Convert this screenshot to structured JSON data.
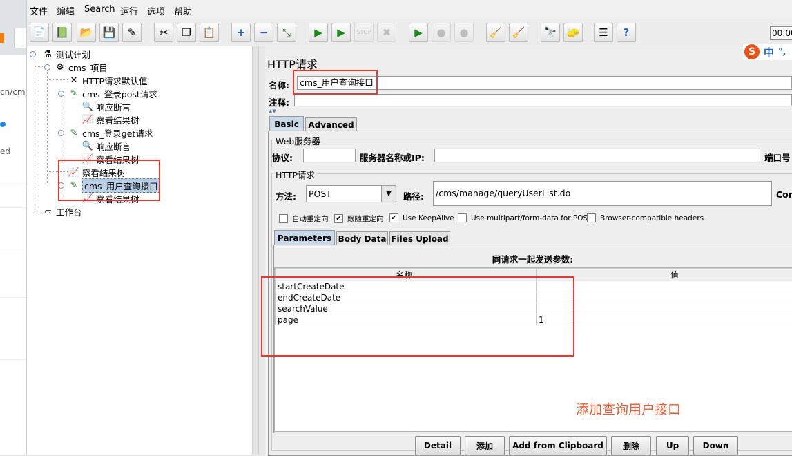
{
  "menu": [
    "文件",
    "编辑",
    "Search",
    "运行",
    "选项",
    "帮助"
  ],
  "toolbar": {
    "timer": "00:00",
    "icons": [
      "new-icon",
      "templates-icon",
      "open-icon",
      "save-icon",
      "save-as-icon",
      "cut-icon",
      "copy-icon",
      "paste-icon",
      "expand-icon",
      "collapse-icon",
      "toggle-icon",
      "start-icon",
      "start-no-pause-icon",
      "stop-icon",
      "shutdown-icon",
      "remote-start-icon",
      "remote-stop-icon",
      "remote-exit-icon",
      "clear-icon",
      "clear-all-icon",
      "search-icon",
      "reset-search-icon",
      "function-helper-icon",
      "help-icon"
    ]
  },
  "tree": {
    "test_plan": "测试计划",
    "project": "cms_项目",
    "http_defaults": "HTTP请求默认值",
    "login_post": "cms_登录post请求",
    "assertion_1": "响应断言",
    "result_tree_1": "察看结果树",
    "login_get": "cms_登录get请求",
    "assertion_2": "响应断言",
    "result_tree_2": "察看结果树",
    "result_tree_3": "察看结果树",
    "user_query": "cms_用户查询接口",
    "result_tree_4": "察看结果树",
    "workbench": "工作台"
  },
  "panel": {
    "title": "HTTP请求",
    "name_label": "名称:",
    "name_value": "cms_用户查询接口",
    "comment_label": "注释:",
    "tabs": [
      "Basic",
      "Advanced"
    ],
    "web_server": {
      "group_title": "Web服务器",
      "protocol_label": "协议:",
      "server_label": "服务器名称或IP:",
      "port_label": "端口号"
    },
    "http_request": {
      "group_title": "HTTP请求",
      "method_label": "方法:",
      "method_value": "POST",
      "path_label": "路径:",
      "path_value": "/cms/manage/queryUserList.do",
      "content_encoding_label": "Con"
    },
    "options": [
      {
        "label": "自动重定向",
        "checked": false
      },
      {
        "label": "跟随重定向",
        "checked": true
      },
      {
        "label": "Use KeepAlive",
        "checked": true
      },
      {
        "label": "Use multipart/form-data for POST",
        "checked": false
      },
      {
        "label": "Browser-compatible headers",
        "checked": false
      }
    ],
    "subtabs": [
      "Parameters",
      "Body Data",
      "Files Upload"
    ],
    "params_caption": "同请求一起发送参数:",
    "columns": [
      "名称:",
      "值"
    ],
    "params": [
      {
        "name": "startCreateDate",
        "value": ""
      },
      {
        "name": "endCreateDate",
        "value": ""
      },
      {
        "name": "searchValue",
        "value": ""
      },
      {
        "name": "page",
        "value": "1"
      }
    ],
    "buttons": [
      "Detail",
      "添加",
      "Add from Clipboard",
      "删除",
      "Up",
      "Down"
    ]
  },
  "annotation": "添加查询用户接口",
  "browser_bg": {
    "url_fragment": "cn/cms",
    "status_fragment": "ed"
  },
  "colors": {
    "annotation_red": "#e53935",
    "selection": "#b8cfe5"
  }
}
